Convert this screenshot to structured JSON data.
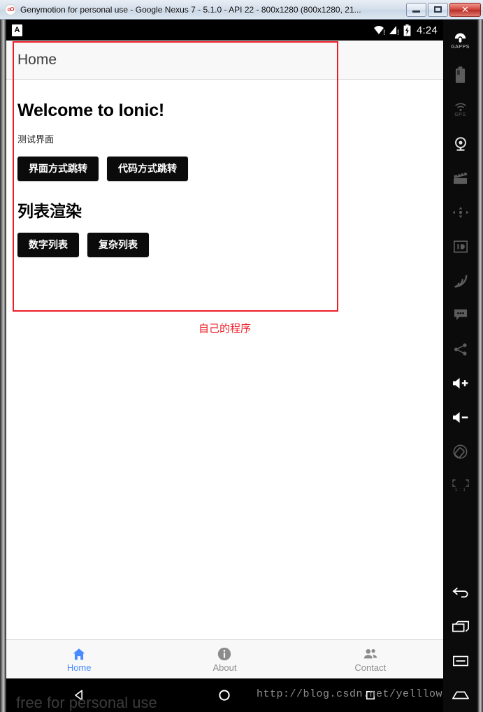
{
  "window": {
    "title": "Genymotion for personal use - Google Nexus 7 - 5.1.0 - API 22 - 800x1280 (800x1280, 21...",
    "icon_name": "genymotion-icon",
    "minimize_label": "Minimize",
    "maximize_label": "Maximize",
    "close_label": "Close"
  },
  "statusbar": {
    "app_icon_letter": "A",
    "wifi_icon": "wifi-warning-icon",
    "cellular_icon": "cellular-warning-icon",
    "battery_icon": "battery-charging-icon",
    "time": "4:24"
  },
  "header": {
    "title": "Home"
  },
  "content": {
    "welcome_heading": "Welcome to Ionic!",
    "subtitle": "测试界面",
    "nav_buttons": [
      {
        "label": "界面方式跳转"
      },
      {
        "label": "代码方式跳转"
      }
    ],
    "list_heading": "列表渲染",
    "list_buttons": [
      {
        "label": "数字列表"
      },
      {
        "label": "复杂列表"
      }
    ],
    "annotation_note": "自己的程序",
    "annotation_color": "#ee1c25"
  },
  "tabbar": {
    "accent_color": "#488aff",
    "inactive_color": "#8c8c8c",
    "tabs": [
      {
        "label": "Home",
        "icon": "home-icon",
        "active": true
      },
      {
        "label": "About",
        "icon": "info-icon",
        "active": false
      },
      {
        "label": "Contact",
        "icon": "people-icon",
        "active": false
      }
    ]
  },
  "navbar": {
    "buttons": [
      {
        "label": "Back",
        "icon": "back-triangle-icon"
      },
      {
        "label": "Home",
        "icon": "home-circle-icon"
      },
      {
        "label": "Recents",
        "icon": "recents-square-icon"
      }
    ]
  },
  "watermark": {
    "text": "free for personal use",
    "url": "http://blog.csdn.net/yelllowcong"
  },
  "toolbar": {
    "items": [
      {
        "name": "gapps-icon",
        "label": "GAPPS"
      },
      {
        "name": "battery-icon",
        "label": ""
      },
      {
        "name": "gps-icon",
        "label": "GPS"
      },
      {
        "name": "camera-icon",
        "label": ""
      },
      {
        "name": "video-icon",
        "label": ""
      },
      {
        "name": "dpad-icon",
        "label": ""
      },
      {
        "name": "identifiers-icon",
        "label": "ID"
      },
      {
        "name": "network-icon",
        "label": ""
      },
      {
        "name": "sms-icon",
        "label": ""
      },
      {
        "name": "share-icon",
        "label": ""
      },
      {
        "name": "volume-up-icon",
        "label": ""
      },
      {
        "name": "volume-down-icon",
        "label": ""
      },
      {
        "name": "rotate-icon",
        "label": ""
      },
      {
        "name": "scale-one-to-one-icon",
        "label": "1 : 1"
      },
      {
        "name": "back-icon",
        "label": ""
      },
      {
        "name": "recents-icon",
        "label": ""
      },
      {
        "name": "menu-icon",
        "label": ""
      },
      {
        "name": "home-icon",
        "label": ""
      }
    ]
  }
}
